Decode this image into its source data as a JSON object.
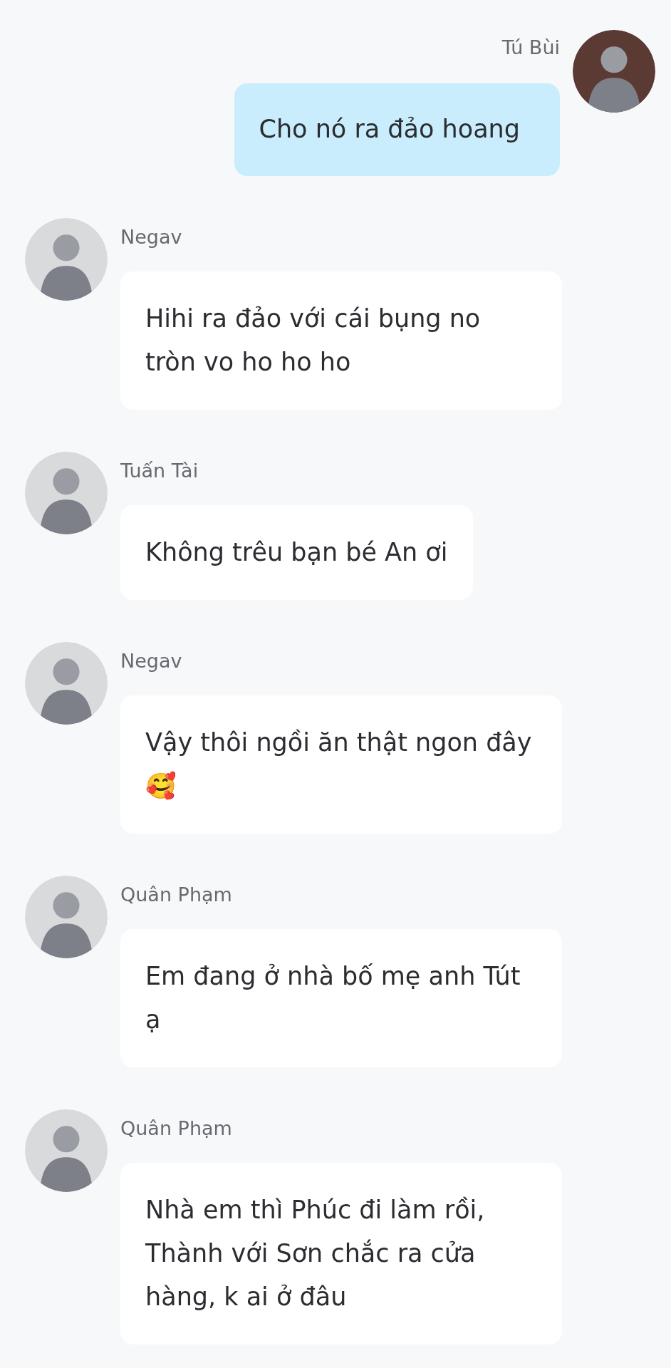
{
  "messages": [
    {
      "sender": "Tú Bùi",
      "kind": "outgoing",
      "text": "Cho nó ra đảo hoang"
    },
    {
      "sender": "Negav",
      "kind": "incoming",
      "text": "Hihi ra đảo với cái bụng no tròn vo ho ho ho"
    },
    {
      "sender": "Tuấn Tài",
      "kind": "incoming",
      "text": "Không trêu bạn bé An ơi"
    },
    {
      "sender": "Negav",
      "kind": "incoming",
      "text": "Vậy thôi ngồi ăn thật ngon đây 🥰"
    },
    {
      "sender": "Quân Phạm",
      "kind": "incoming",
      "text": "Em đang ở nhà bố mẹ anh Tút ạ"
    },
    {
      "sender": "Quân Phạm",
      "kind": "incoming",
      "text": "Nhà em thì Phúc đi làm rồi, Thành với Sơn chắc ra cửa hàng, k ai ở đâu"
    }
  ]
}
